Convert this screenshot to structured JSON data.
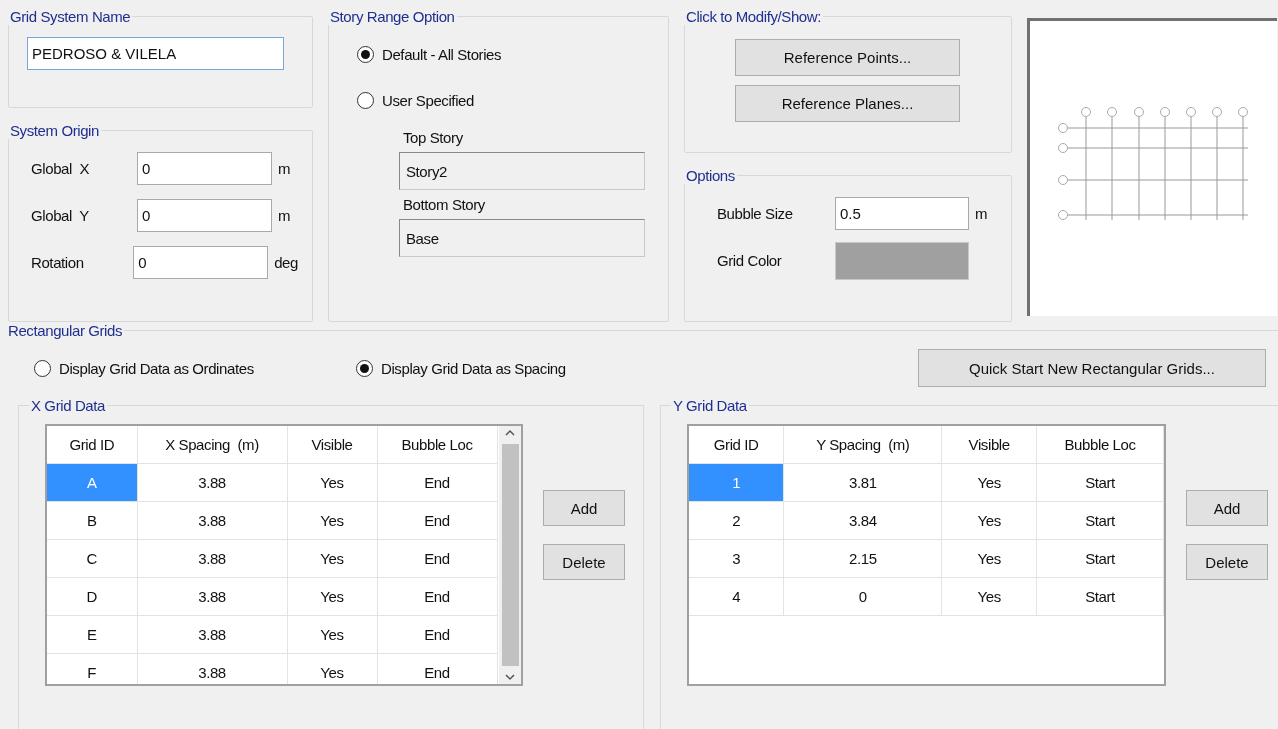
{
  "grid_system_name": {
    "title": "Grid System Name",
    "value": "PEDROSO & VILELA"
  },
  "system_origin": {
    "title": "System Origin",
    "fields": [
      {
        "label": "Global  X",
        "value": "0",
        "unit": "m"
      },
      {
        "label": "Global  Y",
        "value": "0",
        "unit": "m"
      },
      {
        "label": "Rotation",
        "value": "0",
        "unit": "deg"
      }
    ]
  },
  "story_range": {
    "title": "Story Range Option",
    "options": [
      {
        "label": "Default - All Stories",
        "selected": true
      },
      {
        "label": "User Specified",
        "selected": false
      }
    ],
    "stories": [
      {
        "label": "Top Story",
        "value": "Story2",
        "disabled": true
      },
      {
        "label": "Bottom Story",
        "value": "Base",
        "disabled": true
      }
    ]
  },
  "modify": {
    "title": "Click to Modify/Show:",
    "buttons": [
      "Reference Points...",
      "Reference Planes..."
    ]
  },
  "options": {
    "title": "Options",
    "bubble_size": {
      "label": "Bubble Size",
      "value": "0.5",
      "unit": "m"
    },
    "grid_color": {
      "label": "Grid Color",
      "color": "#a0a0a0"
    }
  },
  "rectangular_grids": {
    "title": "Rectangular Grids",
    "display_options": [
      {
        "label": "Display Grid Data as Ordinates",
        "selected": false
      },
      {
        "label": "Display Grid Data as Spacing",
        "selected": true
      }
    ],
    "quick_start_button": "Quick Start New Rectangular Grids..."
  },
  "grids": [
    {
      "title": "X Grid Data",
      "columns": [
        "Grid ID",
        "X Spacing  (m)",
        "Visible",
        "Bubble Loc"
      ],
      "scrollbar": true,
      "rows": [
        {
          "cells": [
            "A",
            "3.88",
            "Yes",
            "End"
          ],
          "selected": true
        },
        {
          "cells": [
            "B",
            "3.88",
            "Yes",
            "End"
          ],
          "selected": false
        },
        {
          "cells": [
            "C",
            "3.88",
            "Yes",
            "End"
          ],
          "selected": false
        },
        {
          "cells": [
            "D",
            "3.88",
            "Yes",
            "End"
          ],
          "selected": false
        },
        {
          "cells": [
            "E",
            "3.88",
            "Yes",
            "End"
          ],
          "selected": false
        },
        {
          "cells": [
            "F",
            "3.88",
            "Yes",
            "End"
          ],
          "selected": false
        }
      ],
      "buttons": [
        "Add",
        "Delete"
      ]
    },
    {
      "title": "Y Grid Data",
      "columns": [
        "Grid ID",
        "Y Spacing  (m)",
        "Visible",
        "Bubble Loc"
      ],
      "scrollbar": false,
      "rows": [
        {
          "cells": [
            "1",
            "3.81",
            "Yes",
            "Start"
          ],
          "selected": true
        },
        {
          "cells": [
            "2",
            "3.84",
            "Yes",
            "Start"
          ],
          "selected": false
        },
        {
          "cells": [
            "3",
            "2.15",
            "Yes",
            "Start"
          ],
          "selected": false
        },
        {
          "cells": [
            "4",
            "0",
            "Yes",
            "Start"
          ],
          "selected": false
        }
      ],
      "buttons": [
        "Add",
        "Delete"
      ]
    }
  ]
}
